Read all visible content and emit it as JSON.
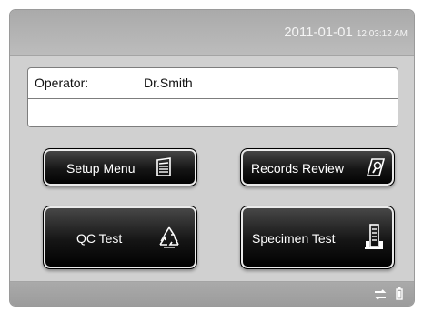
{
  "status_bar": {
    "date": "2011-01-01",
    "time": "12:03:12 AM"
  },
  "operator": {
    "label": "Operator:",
    "name": "Dr.Smith"
  },
  "menu": {
    "setup_label": "Setup Menu",
    "records_label": "Records Review",
    "qc_label": "QC Test",
    "specimen_label": "Specimen Test"
  },
  "icons": {
    "setup": "list-icon",
    "records": "records-search-icon",
    "qc": "recycle-icon",
    "specimen": "specimen-rack-icon",
    "connection": "transfer-arrows-icon",
    "battery": "battery-icon"
  },
  "colors": {
    "screen_bg": "#d0d0d0",
    "bar_bg": "#aaaaaa",
    "button_bg": "#151515",
    "button_text": "#ffffff",
    "clock_text": "#f4f4f4"
  }
}
